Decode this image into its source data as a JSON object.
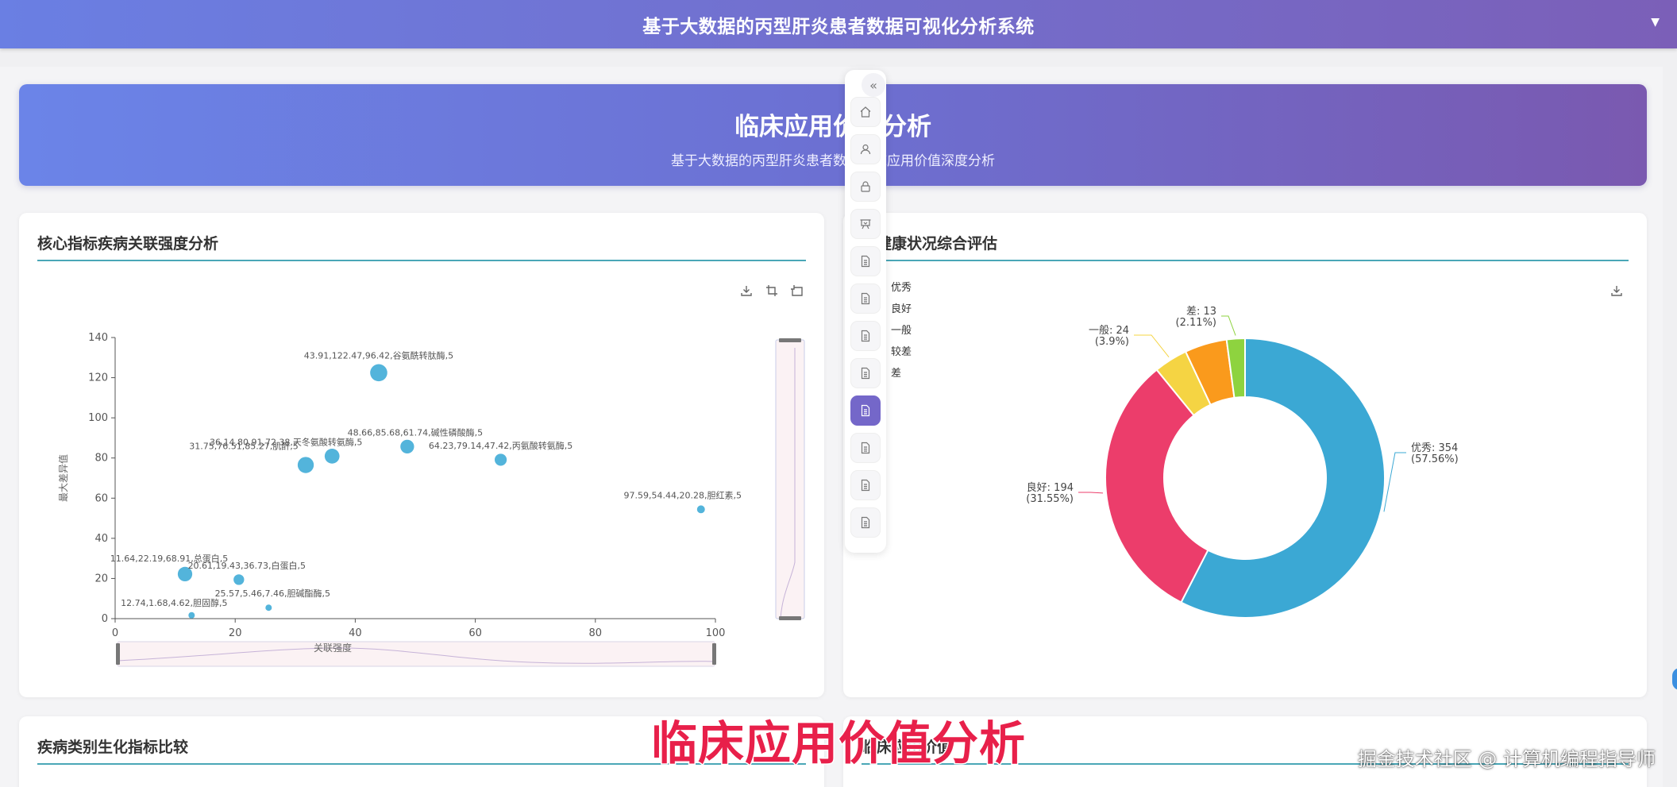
{
  "header": {
    "title": "基于大数据的丙型肝炎患者数据可视化分析系统"
  },
  "hero": {
    "title": "临床应用价值分析",
    "subtitle": "基于大数据的丙型肝炎患者数据临床应用价值深度分析"
  },
  "cards": {
    "scatter_title": "核心指标疾病关联强度分析",
    "pie_title": "肝健康状况综合评估",
    "bottom_left_title": "疾病类别生化指标比较",
    "bottom_right_title": "临床应用价值"
  },
  "overlay": {
    "subtitle": "临床应用价值分析",
    "watermark": "掘金技术社区 @ 计算机编程指导师"
  },
  "chart_data": [
    {
      "type": "scatter",
      "title": "核心指标疾病关联强度分析",
      "xlabel": "关联强度",
      "ylabel": "最大差异值",
      "xlim": [
        0,
        100
      ],
      "ylim": [
        0,
        140
      ],
      "xticks": [
        0,
        20,
        40,
        60,
        80,
        100
      ],
      "yticks": [
        0,
        20,
        40,
        60,
        80,
        100,
        120,
        140
      ],
      "points": [
        {
          "x": 43.91,
          "y": 122.47,
          "size": 96.42,
          "name": "谷氨酰转肽酶",
          "label": "43.91,122.47,96.42,谷氨酰转肽酶,5"
        },
        {
          "x": 48.66,
          "y": 85.68,
          "size": 61.74,
          "name": "碱性磷酸酶",
          "label": "48.66,85.68,61.74,碱性磷酸酶,5"
        },
        {
          "x": 36.14,
          "y": 80.91,
          "size": 72.38,
          "name": "天冬氨酸转氨酶",
          "label": "36.14,80.91,72.38,天冬氨酸转氨酶,5"
        },
        {
          "x": 31.75,
          "y": 76.51,
          "size": 85.27,
          "name": "肌酐",
          "label": "31.75,76.51,85.27,肌酐,5"
        },
        {
          "x": 64.23,
          "y": 79.14,
          "size": 47.42,
          "name": "丙氨酸转氨酶",
          "label": "64.23,79.14,47.42,丙氨酸转氨酶,5"
        },
        {
          "x": 97.59,
          "y": 54.44,
          "size": 20.28,
          "name": "胆红素",
          "label": "97.59,54.44,20.28,胆红素,5"
        },
        {
          "x": 11.64,
          "y": 22.19,
          "size": 68.91,
          "name": "总蛋白",
          "label": "11.64,22.19,68.91,总蛋白,5"
        },
        {
          "x": 20.61,
          "y": 19.43,
          "size": 36.73,
          "name": "白蛋白",
          "label": "20.61,19.43,36.73,白蛋白,5"
        },
        {
          "x": 25.57,
          "y": 5.46,
          "size": 7.46,
          "name": "胆碱酯酶",
          "label": "25.57,5.46,7.46,胆碱酯酶,5"
        },
        {
          "x": 12.74,
          "y": 1.68,
          "size": 4.62,
          "name": "胆固醇",
          "label": "12.74,1.68,4.62,胆固醇,5"
        }
      ],
      "color": "#4ab0d9"
    },
    {
      "type": "pie",
      "title": "肝健康状况综合评估",
      "legend": [
        "优秀",
        "良好",
        "一般",
        "较差",
        "差"
      ],
      "legend_position": "top-left",
      "slices": [
        {
          "name": "优秀",
          "value": 354,
          "percent": "57.56%",
          "color": "#3ba8d4"
        },
        {
          "name": "良好",
          "value": 194,
          "percent": "31.55%",
          "color": "#ec3d6b"
        },
        {
          "name": "一般",
          "value": 24,
          "percent": "3.9%",
          "color": "#f5d443"
        },
        {
          "name": "较差",
          "value": 30,
          "percent": "4.88%",
          "color": "#fa9a1c"
        },
        {
          "name": "差",
          "value": 13,
          "percent": "2.11%",
          "color": "#8ed33f"
        }
      ],
      "labels": [
        {
          "name": "优秀",
          "line1": "优秀: 354",
          "line2": "(57.56%)"
        },
        {
          "name": "良好",
          "line1": "良好: 194",
          "line2": "(31.55%)"
        },
        {
          "name": "一般",
          "line1": "一般: 24",
          "line2": "(3.9%)"
        },
        {
          "name": "差",
          "line1": "差: 13",
          "line2": "(2.11%)"
        }
      ]
    }
  ]
}
